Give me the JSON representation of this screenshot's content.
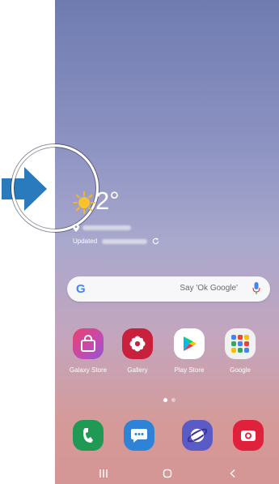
{
  "weather": {
    "temperature": "2°",
    "updated_label": "Updated"
  },
  "search": {
    "placeholder": "Say 'Ok Google'"
  },
  "apps": [
    {
      "label": "Galaxy Store",
      "icon": "shopping-bag-icon",
      "color": "#d24f93"
    },
    {
      "label": "Gallery",
      "icon": "flower-icon",
      "color": "#c9203e"
    },
    {
      "label": "Play Store",
      "icon": "play-store-icon",
      "color": "#ffffff"
    },
    {
      "label": "Google",
      "icon": "google-folder-icon",
      "color": "#f1f1f1"
    }
  ],
  "dock": [
    {
      "name": "phone",
      "icon": "phone-icon",
      "color": "#1f9954"
    },
    {
      "name": "messages",
      "icon": "message-icon",
      "color": "#2f83d6"
    },
    {
      "name": "internet",
      "icon": "internet-icon",
      "color": "#5b5bc8"
    },
    {
      "name": "camera",
      "icon": "camera-icon",
      "color": "#e0213c"
    }
  ],
  "navbar": {
    "recent": "recent-apps-icon",
    "home": "home-icon",
    "back": "back-icon"
  },
  "colors": {
    "arrow": "#2a7bbd",
    "wallpaper_top": "#6f7bb0",
    "wallpaper_bottom": "#d59595"
  }
}
